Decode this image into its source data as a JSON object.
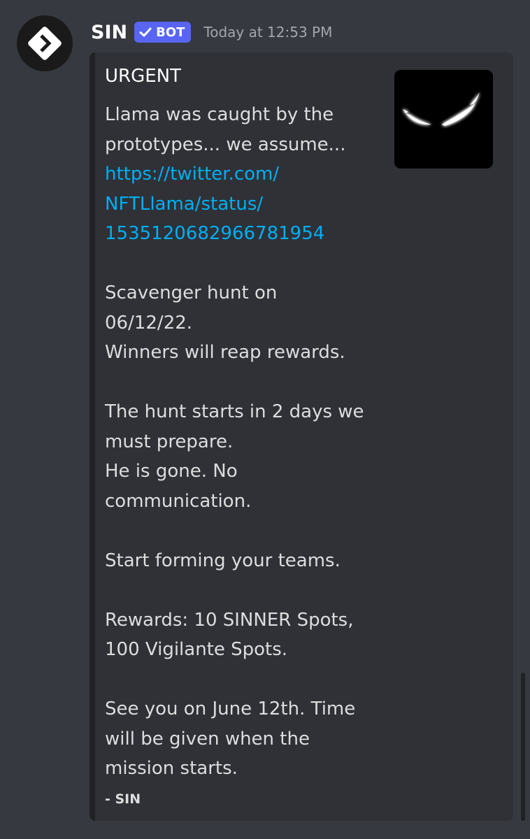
{
  "message": {
    "author": "SIN",
    "bot_tag": "BOT",
    "timestamp": "Today at 12:53 PM"
  },
  "embed": {
    "title": "URGENT",
    "body_lines": [
      "Llama was caught by the",
      "prototypes... we assume..."
    ],
    "link_lines": [
      "https://twitter.com/",
      "NFTLlama/status/",
      "1535120682966781954"
    ],
    "paragraphs": {
      "hunt_1": "Scavenger hunt on",
      "hunt_2": "06/12/22.",
      "hunt_3": "Winners will reap rewards.",
      "start_1": "The hunt starts in 2 days we",
      "start_2": "must prepare.",
      "start_3": "He is gone. No",
      "start_4": "communication.",
      "teams": "Start forming your teams.",
      "rewards_1": "Rewards: 10 SINNER Spots,",
      "rewards_2": "100 Vigilante Spots.",
      "see_1": "See you on June 12th. Time",
      "see_2": "will be given when the",
      "see_3": "mission starts."
    },
    "footer": "- SIN"
  },
  "colors": {
    "background": "#36393f",
    "embed_background": "#2f3136",
    "link": "#00aff4",
    "bot_tag": "#5865f2"
  },
  "icons": {
    "avatar": "diamond-logo-icon",
    "bot_verified": "checkmark-icon",
    "thumbnail": "glowing-eyes-image"
  }
}
